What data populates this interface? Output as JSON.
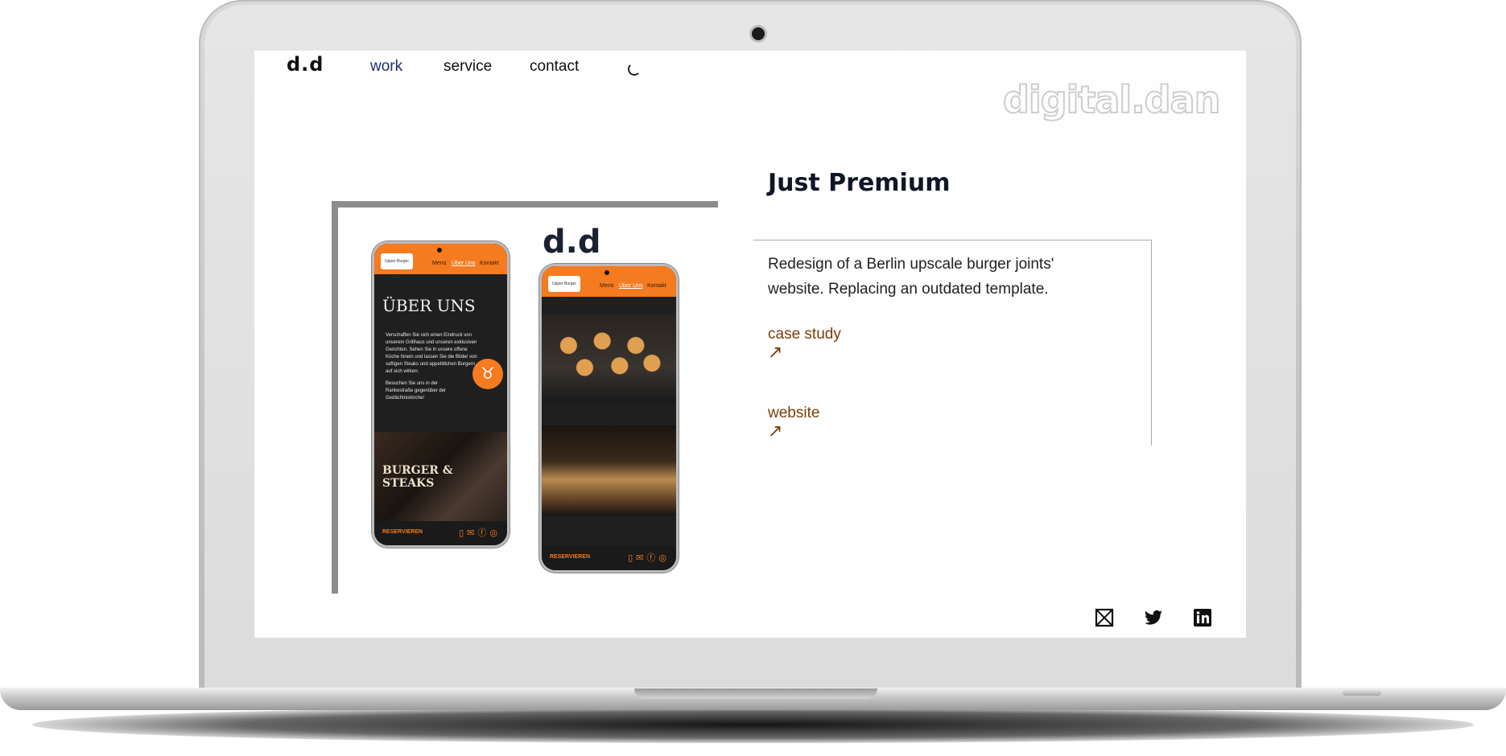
{
  "header": {
    "logo": "d.d",
    "nav": [
      "work",
      "service",
      "contact"
    ],
    "brand_watermark": "digital.dan"
  },
  "project": {
    "mini_logo": "d.d",
    "title": "Just Premium",
    "description": "Redesign of a Berlin upscale burger joints' website. Replacing an outdated template.",
    "links": [
      {
        "label": "case study",
        "arrow": "↗"
      },
      {
        "label": "website",
        "arrow": "↗"
      }
    ]
  },
  "mockups": {
    "phone_nav": [
      "Menü",
      "Über Uns",
      "Kontakt"
    ],
    "phone_logo_text": "Upper Burger Grill",
    "heading": "ÜBER UNS",
    "body_text": "Verschaffen Sie sich einen Eindruck von unserem Grillhaus und unseren exklusiven Gerichten. Sehen Sie in unsere offene Küche hinein und lassen Sie die Bilder von saftigen Steaks und appetitlichen Burgern auf sich wirken.",
    "body_text_2": "Besuchen Sie uns in der Rankestraße gegenüber der Gedächtniskirche!",
    "banner": "BURGER & STEAKS",
    "cta": "RESERVIEREN"
  },
  "social": [
    "mail-icon",
    "twitter-icon",
    "linkedin-icon"
  ],
  "colors": {
    "accent": "#f47b20",
    "nav_active": "#1f2e6e",
    "link": "#7a3d0a"
  }
}
